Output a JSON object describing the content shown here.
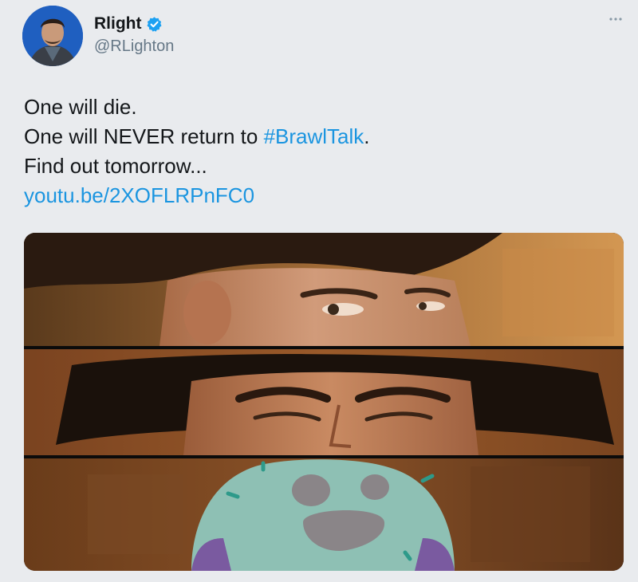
{
  "author": {
    "display_name": "Rlight",
    "handle": "@RLighton",
    "verified": true,
    "avatar_icon": "avatar-photo"
  },
  "tweet": {
    "lines": [
      "One will die.",
      "One will NEVER return to ",
      "Find out tomorrow..."
    ],
    "hashtag": "#BrawlTalk",
    "line2_suffix": ".",
    "link": "youtu.be/2XOFLRPnFC0"
  },
  "menu": {
    "icon": "more-icon"
  },
  "colors": {
    "link": "#1b95e0",
    "verified": "#1da1f2",
    "background": "#e9ebee"
  },
  "media": {
    "panels": [
      "cowboy-eyes-left",
      "cowboy-eyes-squint",
      "cactus-plush"
    ]
  }
}
